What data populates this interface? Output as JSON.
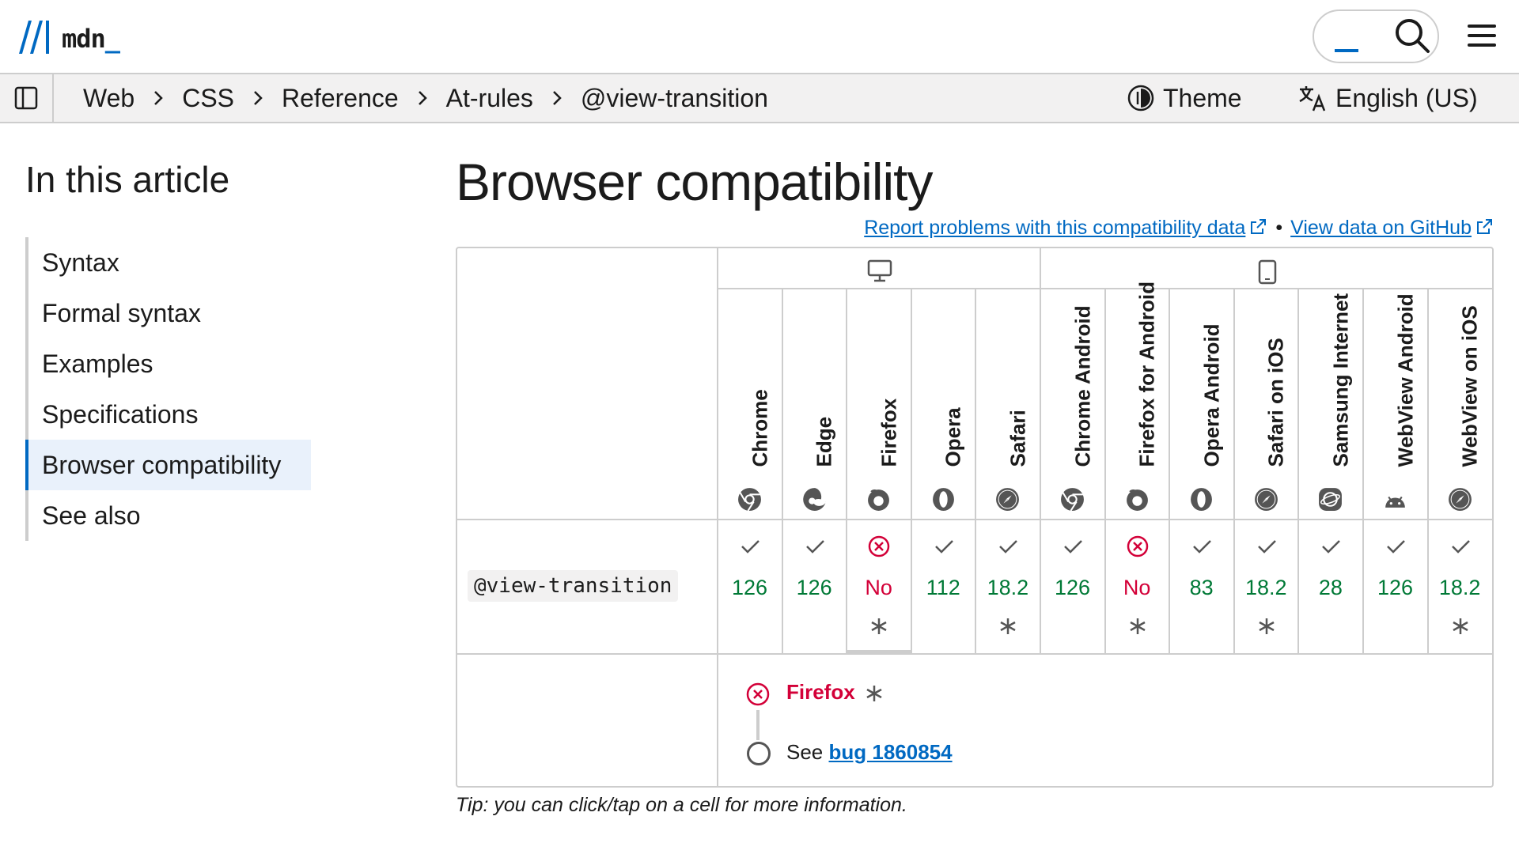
{
  "header": {
    "logo_text": "mdn",
    "logo_underscore": "_"
  },
  "breadcrumbs": [
    "Web",
    "CSS",
    "Reference",
    "At-rules",
    "@view-transition"
  ],
  "toolbar": {
    "theme_label": "Theme",
    "language_label": "English (US)"
  },
  "toc": {
    "title": "In this article",
    "items": [
      "Syntax",
      "Formal syntax",
      "Examples",
      "Specifications",
      "Browser compatibility",
      "See also"
    ],
    "active": "Browser compatibility"
  },
  "main": {
    "title": "Browser compatibility",
    "report_link": "Report problems with this compatibility data",
    "bullet": "•",
    "github_link": "View data on GitHub",
    "tip": "Tip: you can click/tap on a cell for more information."
  },
  "compat": {
    "feature": "@view-transition",
    "platforms": [
      "desktop-icon",
      "mobile-icon"
    ],
    "browsers": [
      {
        "name": "Chrome",
        "icon": "chrome-icon",
        "support": "yes",
        "version": "126",
        "note": false
      },
      {
        "name": "Edge",
        "icon": "edge-icon",
        "support": "yes",
        "version": "126",
        "note": false
      },
      {
        "name": "Firefox",
        "icon": "firefox-icon",
        "support": "no",
        "version": "No",
        "note": true
      },
      {
        "name": "Opera",
        "icon": "opera-icon",
        "support": "yes",
        "version": "112",
        "note": false
      },
      {
        "name": "Safari",
        "icon": "safari-icon",
        "support": "yes",
        "version": "18.2",
        "note": true
      },
      {
        "name": "Chrome Android",
        "icon": "chrome-icon",
        "support": "yes",
        "version": "126",
        "note": false
      },
      {
        "name": "Firefox for Android",
        "icon": "firefox-icon",
        "support": "no",
        "version": "No",
        "note": true
      },
      {
        "name": "Opera Android",
        "icon": "opera-icon",
        "support": "yes",
        "version": "83",
        "note": false
      },
      {
        "name": "Safari on iOS",
        "icon": "safari-icon",
        "support": "yes",
        "version": "18.2",
        "note": true
      },
      {
        "name": "Samsung Internet",
        "icon": "samsung-internet-icon",
        "support": "yes",
        "version": "28",
        "note": false
      },
      {
        "name": "WebView Android",
        "icon": "android-icon",
        "support": "yes",
        "version": "126",
        "note": false
      },
      {
        "name": "WebView on iOS",
        "icon": "safari-icon",
        "support": "yes",
        "version": "18.2",
        "note": true
      }
    ],
    "detail": {
      "browser": "Firefox",
      "note_prefix": "See",
      "note_link": "bug 1860854"
    }
  },
  "colors": {
    "link": "#0069c2",
    "supported": "#007936",
    "unsupported": "#d30038",
    "border": "#cdcdcd",
    "active_bg": "#e9f1fb"
  }
}
